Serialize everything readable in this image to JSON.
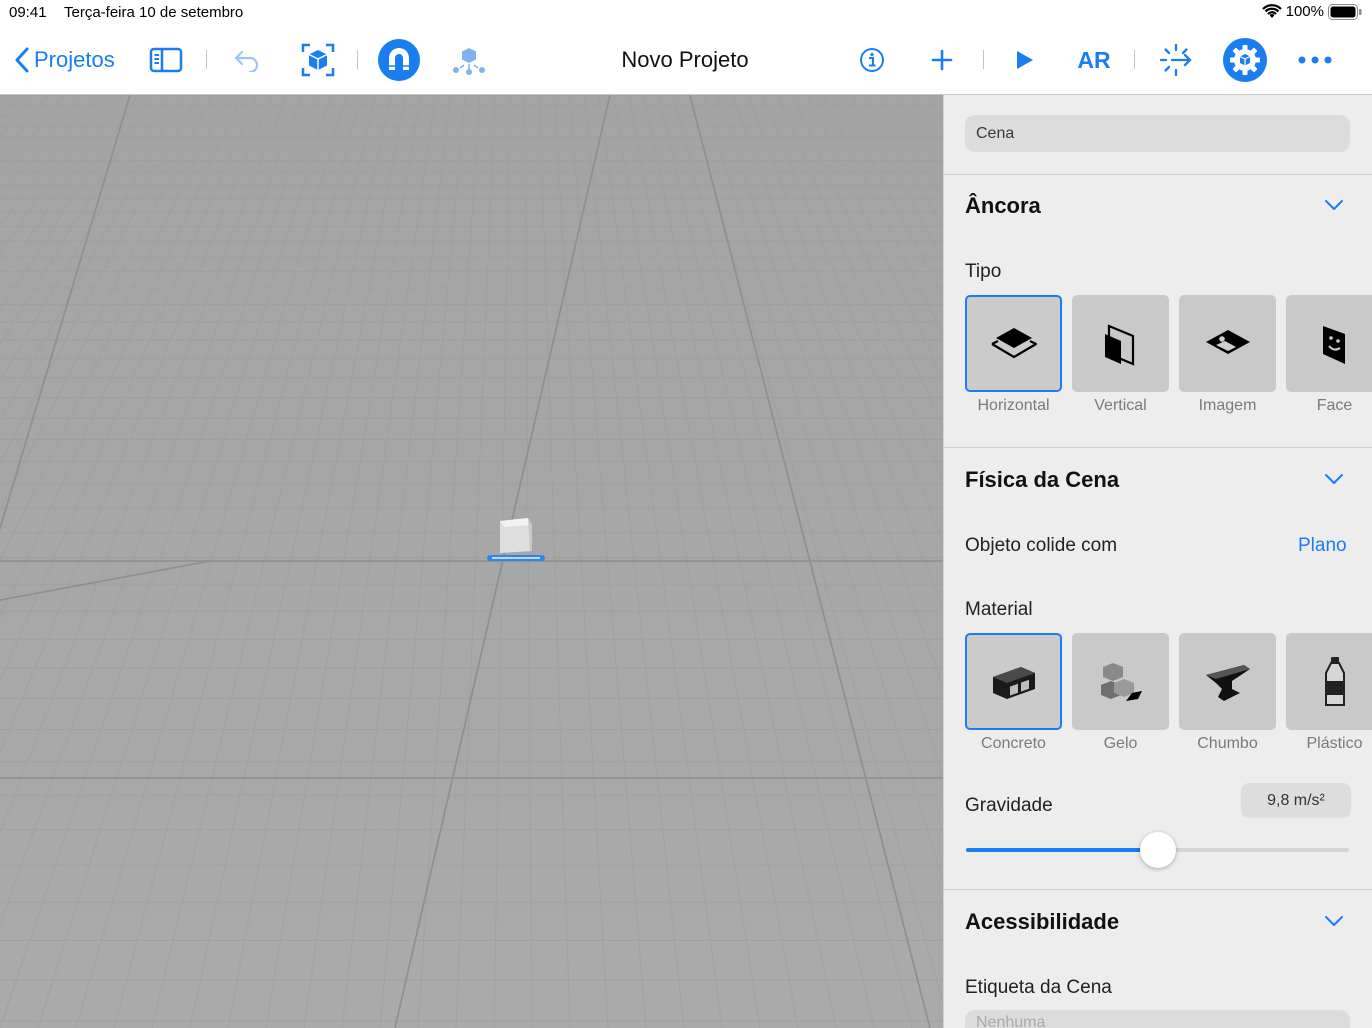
{
  "status": {
    "time": "09:41",
    "date": "Terça-feira 10 de setembro",
    "battery": "100%"
  },
  "toolbar": {
    "back_label": "Projetos",
    "title": "Novo Projeto",
    "ar_label": "AR",
    "icons": [
      "sidebar-icon",
      "undo-icon",
      "object-box-icon",
      "snap-magnet-icon",
      "scene-objects-icon",
      "info-icon",
      "add-icon",
      "play-icon",
      "transform-icon",
      "properties-gear-icon",
      "more-icon"
    ]
  },
  "panel": {
    "scene_name": "Cena",
    "anchor": {
      "title": "Âncora",
      "type_label": "Tipo",
      "types": [
        {
          "label": "Horizontal",
          "selected": true
        },
        {
          "label": "Vertical",
          "selected": false
        },
        {
          "label": "Imagem",
          "selected": false
        },
        {
          "label": "Face",
          "selected": false
        }
      ]
    },
    "physics": {
      "title": "Física da Cena",
      "collide_label": "Objeto colide com",
      "collide_value": "Plano",
      "material_label": "Material",
      "materials": [
        {
          "label": "Concreto",
          "selected": true
        },
        {
          "label": "Gelo",
          "selected": false
        },
        {
          "label": "Chumbo",
          "selected": false
        },
        {
          "label": "Plástico",
          "selected": false
        }
      ],
      "gravity_label": "Gravidade",
      "gravity_value": "9,8 m/s²",
      "gravity_fraction": 0.5
    },
    "accessibility": {
      "title": "Acessibilidade",
      "scene_label_title": "Etiqueta da Cena",
      "scene_label_placeholder": "Nenhuma"
    }
  },
  "colors": {
    "accent": "#1a7df0",
    "viewport": "#a8a8a8",
    "panel": "#ededed"
  }
}
